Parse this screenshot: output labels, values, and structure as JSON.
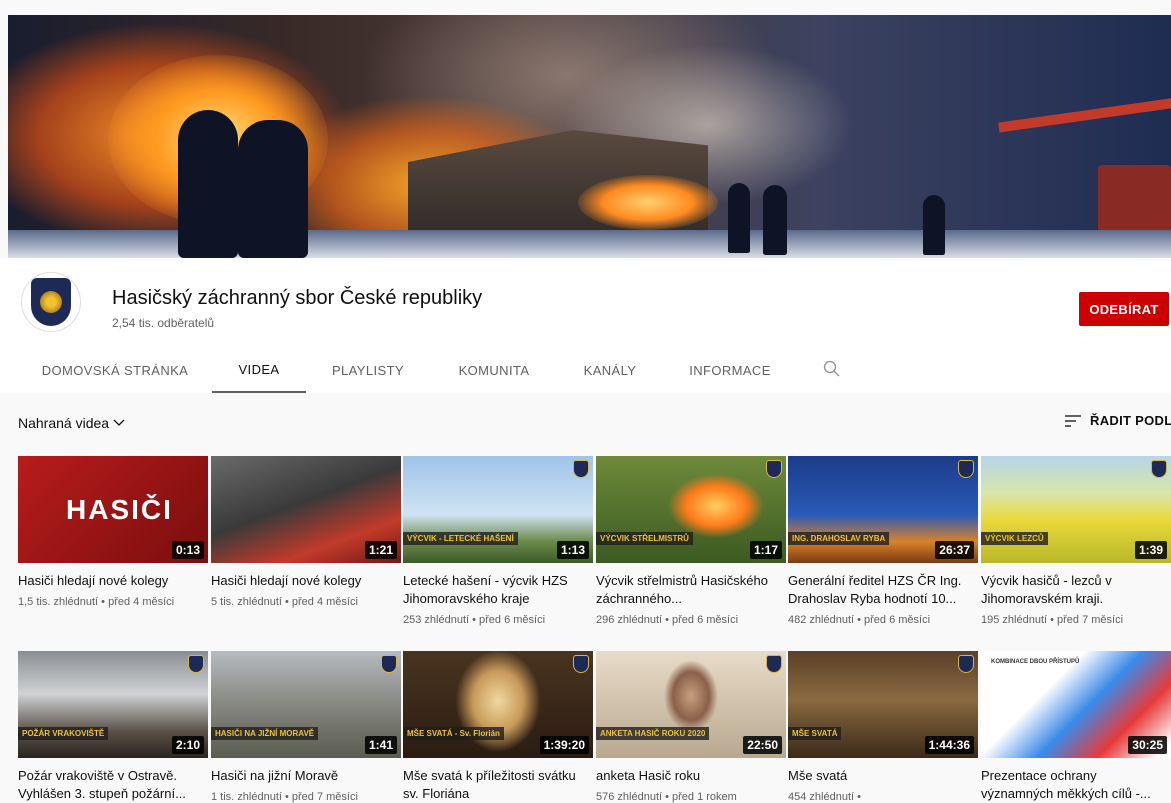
{
  "channel": {
    "title": "Hasičský záchranný sbor České republiky",
    "subscribers": "2,54 tis. odběratelů",
    "subscribe_label": "ODEBÍRAT",
    "accent": "#cc0000"
  },
  "tabs": [
    {
      "label": "DOMOVSKÁ STRÁNKA"
    },
    {
      "label": "VIDEA",
      "active": true
    },
    {
      "label": "PLAYLISTY"
    },
    {
      "label": "KOMUNITA"
    },
    {
      "label": "KANÁLY"
    },
    {
      "label": "INFORMACE"
    }
  ],
  "filter": {
    "label": "Nahraná videa"
  },
  "sort": {
    "label": "ŘADIT PODLE"
  },
  "videos": [
    {
      "title": "Hasiči hledají nové kolegy",
      "meta": "1,5 tis. zhlédnutí • před 4 měsíci",
      "duration": "0:13",
      "caption": "",
      "thumb_text": "HASIČI"
    },
    {
      "title": "Hasiči hledají nové kolegy",
      "meta": "5 tis. zhlédnutí • před 4 měsíci",
      "duration": "1:21",
      "caption": "",
      "thumb_text": ""
    },
    {
      "title": "Letecké hašení - výcvik HZS Jihomoravského kraje",
      "meta": "253 zhlédnutí • před 6 měsíci",
      "duration": "1:13",
      "caption": "VÝCVIK - LETECKÉ HAŠENÍ",
      "thumb_text": ""
    },
    {
      "title": "Výcvik střelmistrů Hasičského záchranného...",
      "meta": "296 zhlédnutí • před 6 měsíci",
      "duration": "1:17",
      "caption": "VÝCVIK STŘELMISTRŮ",
      "thumb_text": ""
    },
    {
      "title": "Generální ředitel HZS ČR Ing. Drahoslav Ryba hodnotí 10...",
      "meta": "482 zhlédnutí • před 6 měsíci",
      "duration": "26:37",
      "caption": "ING. DRAHOSLAV RYBA",
      "thumb_text": ""
    },
    {
      "title": "Výcvik hasičů - lezců v Jihomoravském kraji.",
      "meta": "195 zhlédnutí • před 7 měsíci",
      "duration": "1:39",
      "caption": "VÝCVIK LEZCŮ",
      "thumb_text": ""
    },
    {
      "title": "Požár vrakoviště v Ostravě. Vyhlášen 3. stupeň požární...",
      "meta": "",
      "duration": "2:10",
      "caption": "POŽÁR VRAKOVIŠTĚ",
      "thumb_text": ""
    },
    {
      "title": "Hasiči na jižní Moravě",
      "meta": "1 tis. zhlédnutí • před 7 měsíci",
      "duration": "1:41",
      "caption": "HASIČI NA JIŽNÍ MORAVĚ",
      "thumb_text": ""
    },
    {
      "title": "Mše svatá k příležitosti svátku sv. Floriána",
      "meta": "",
      "duration": "1:39:20",
      "caption": "MŠE SVATÁ - Sv. Florián",
      "thumb_text": ""
    },
    {
      "title": "anketa Hasič roku",
      "meta": "576 zhlédnutí • před 1 rokem",
      "duration": "22:50",
      "caption": "ANKETA HASIČ ROKU 2020",
      "thumb_text": ""
    },
    {
      "title": "Mše svatá",
      "meta": "454 zhlédnutí •",
      "duration": "1:44:36",
      "caption": "MŠE SVATÁ",
      "thumb_text": ""
    },
    {
      "title": "Prezentace ochrany významných měkkých cílů -...",
      "meta": "",
      "duration": "30:25",
      "caption": "",
      "thumb_text": "KOMBINACE DBOU PŘÍSTUPŮ"
    }
  ],
  "icons": {
    "search": "search-icon",
    "sort": "sort-icon",
    "chevron": "chevron-down-icon"
  }
}
